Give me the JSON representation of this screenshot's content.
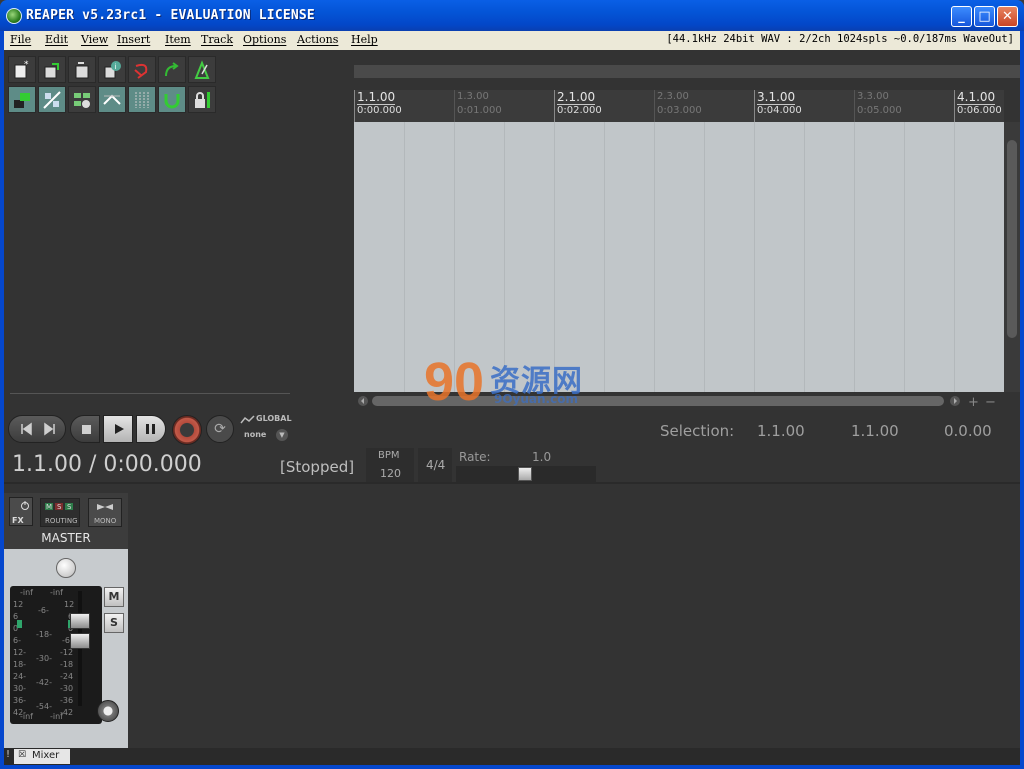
{
  "window": {
    "title": "REAPER v5.23rc1 - EVALUATION LICENSE",
    "minimize": "_",
    "maximize": "□",
    "close": "✕"
  },
  "menu": {
    "items": [
      "File",
      "Edit",
      "View",
      "Insert",
      "Item",
      "Track",
      "Options",
      "Actions",
      "Help"
    ],
    "status": "[44.1kHz 24bit WAV : 2/2ch 1024spls ~0.0/187ms WaveOut]"
  },
  "ruler": {
    "marks": [
      {
        "bar": "1.1.00",
        "time": "0:00.000",
        "minor": false
      },
      {
        "bar": "1.3.00",
        "time": "0:01.000",
        "minor": true
      },
      {
        "bar": "2.1.00",
        "time": "0:02.000",
        "minor": false
      },
      {
        "bar": "2.3.00",
        "time": "0:03.000",
        "minor": true
      },
      {
        "bar": "3.1.00",
        "time": "0:04.000",
        "minor": false
      },
      {
        "bar": "3.3.00",
        "time": "0:05.000",
        "minor": true
      },
      {
        "bar": "4.1.00",
        "time": "0:06.000",
        "minor": false
      }
    ]
  },
  "watermark": {
    "text": "资源网",
    "sub": "9Oyuan.com"
  },
  "transport": {
    "global_label": "GLOBAL",
    "global_value": "none",
    "selection_label": "Selection:",
    "selection_start": "1.1.00",
    "selection_end": "1.1.00",
    "selection_length": "0.0.00",
    "position": "1.1.00 / 0:00.000",
    "state": "[Stopped]",
    "bpm_label": "BPM",
    "bpm_value": "120",
    "time_signature": "4/4",
    "rate_label": "Rate:",
    "rate_value": "1.0"
  },
  "mixer": {
    "fx_label": "FX",
    "routing_label": "ROUTING",
    "mono_label": "MONO",
    "master_name": "MASTER",
    "mute": "M",
    "solo": "S",
    "meter_left_top": "-inf",
    "meter_right_top": "-inf",
    "meter_left_bottom": "-inf",
    "meter_right_bottom": "-inf",
    "scale_left": [
      "12",
      "6",
      "0",
      "6-",
      "12-",
      "18-",
      "24-",
      "30-",
      "36-",
      "42-"
    ],
    "scale_mid": [
      "-6-",
      "-18-",
      "-30-",
      "-42-",
      "-54-"
    ],
    "scale_right": [
      "12",
      "6",
      "0",
      "-6",
      "-12",
      "-18",
      "-24",
      "-30",
      "-36",
      "-42"
    ],
    "tab_label": "Mixer"
  }
}
